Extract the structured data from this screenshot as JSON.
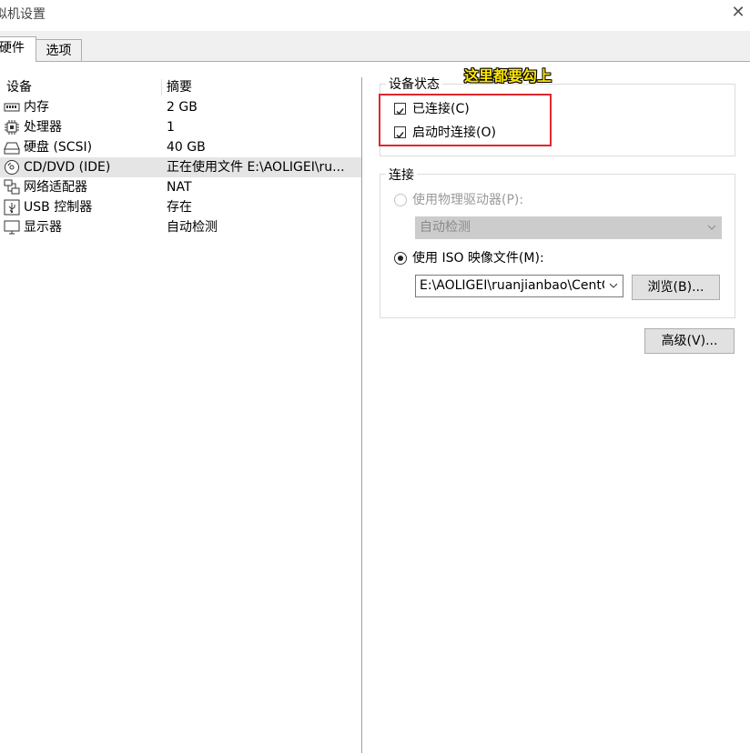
{
  "window": {
    "title": "拟机设置",
    "close_icon": "close-icon"
  },
  "tabs": [
    {
      "label": "硬件",
      "active": true
    },
    {
      "label": "选项",
      "active": false
    }
  ],
  "device_list": {
    "col_device": "设备",
    "col_summary": "摘要",
    "rows": [
      {
        "icon": "memory-icon",
        "name": "内存",
        "summary": "2 GB",
        "selected": false
      },
      {
        "icon": "processor-icon",
        "name": "处理器",
        "summary": "1",
        "selected": false
      },
      {
        "icon": "hard-disk-icon",
        "name": "硬盘 (SCSI)",
        "summary": "40 GB",
        "selected": false
      },
      {
        "icon": "cd-dvd-icon",
        "name": "CD/DVD (IDE)",
        "summary": "正在使用文件 E:\\AOLIGEI\\ru...",
        "selected": true
      },
      {
        "icon": "network-adapter-icon",
        "name": "网络适配器",
        "summary": "NAT",
        "selected": false
      },
      {
        "icon": "usb-icon",
        "name": "USB 控制器",
        "summary": "存在",
        "selected": false
      },
      {
        "icon": "display-icon",
        "name": "显示器",
        "summary": "自动检测",
        "selected": false
      }
    ]
  },
  "device_status": {
    "group_label": "设备状态",
    "connected_label": "已连接(C)",
    "connected_checked": true,
    "connect_on_power_label": "启动时连接(O)",
    "connect_on_power_checked": true
  },
  "connection": {
    "group_label": "连接",
    "physical_drive_label": "使用物理驱动器(P):",
    "physical_drive_value": "自动检测",
    "iso_label": "使用 ISO 映像文件(M):",
    "iso_path": "E:\\AOLIGEI\\ruanjianbao\\CentC",
    "browse_label": "浏览(B)..."
  },
  "advanced_label": "高级(V)...",
  "annotation": {
    "text": "这里都要勾上",
    "color": "#ffe600",
    "box_color": "#e0272e"
  }
}
